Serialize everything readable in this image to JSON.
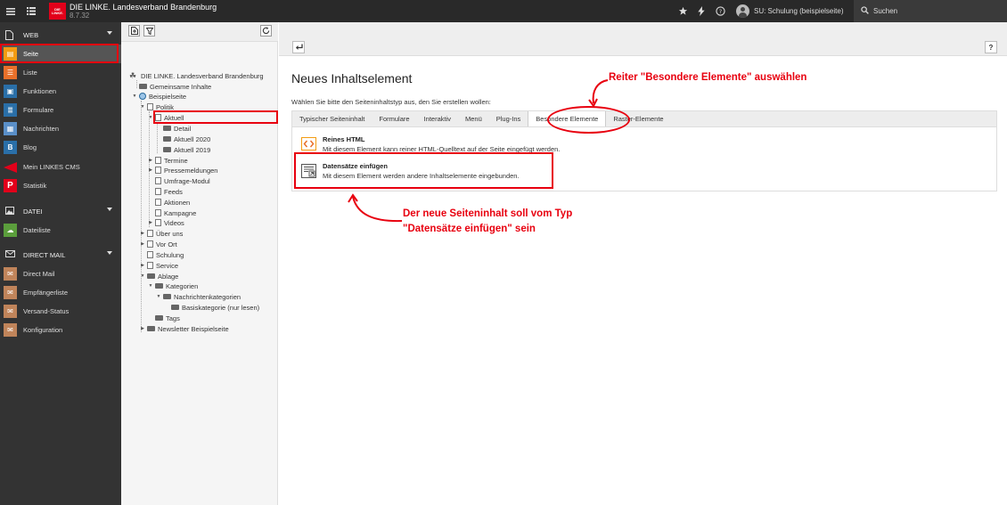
{
  "topbar": {
    "site_title": "DIE LINKE. Landesverband Brandenburg",
    "version": "8.7.32",
    "logo_text": "DIE LINKE.",
    "user": "SU: Schulung (beispielseite)",
    "search_label": "Suchen"
  },
  "modules": {
    "web_label": "WEB",
    "web_items": [
      {
        "label": "Seite",
        "icon": "page-icon",
        "color": "#f39c12"
      },
      {
        "label": "Liste",
        "icon": "list-icon",
        "color": "#e8702a"
      },
      {
        "label": "Funktionen",
        "icon": "briefcase-icon",
        "color": "#2a6fa8"
      },
      {
        "label": "Formulare",
        "icon": "form-icon",
        "color": "#2a6fa8"
      },
      {
        "label": "Nachrichten",
        "icon": "news-icon",
        "color": "#2a6fa8"
      },
      {
        "label": "Blog",
        "icon": "blog-icon",
        "color": "#2a6fa8"
      },
      {
        "label": "Mein LINKES CMS",
        "icon": "linke-arrow-icon",
        "color": "#e2001a"
      },
      {
        "label": "Statistik",
        "icon": "statistics-p-icon",
        "color": "#e2001a"
      }
    ],
    "datei_label": "DATEI",
    "datei_items": [
      {
        "label": "Dateiliste",
        "icon": "cloud-icon",
        "color": "#5b9e3c"
      }
    ],
    "direct_mail_label": "DIRECT MAIL",
    "direct_mail_items": [
      {
        "label": "Direct Mail",
        "icon": "mail-icon",
        "color": "#c0845a"
      },
      {
        "label": "Empfängerliste",
        "icon": "recipients-icon",
        "color": "#c0845a"
      },
      {
        "label": "Versand-Status",
        "icon": "mail-status-icon",
        "color": "#c0845a"
      },
      {
        "label": "Konfiguration",
        "icon": "mail-config-icon",
        "color": "#c0845a"
      }
    ]
  },
  "tree": {
    "root": "DIE LINKE. Landesverband Brandenburg",
    "nodes": [
      "Gemeinsame Inhalte",
      "Beispielseite",
      "Politik",
      "Aktuell",
      "Detail",
      "Aktuell 2020",
      "Aktuell 2019",
      "Termine",
      "Pressemeldungen",
      "Umfrage-Modul",
      "Feeds",
      "Aktionen",
      "Kampagne",
      "Videos",
      "Über uns",
      "Vor Ort",
      "Schulung",
      "Service",
      "Ablage",
      "Kategorien",
      "Nachrichtenkategorien",
      "Basiskategorie (nur lesen)",
      "Tags",
      "Newsletter Beispielseite"
    ]
  },
  "content": {
    "title": "Neues Inhaltselement",
    "intro": "Wählen Sie bitte den Seiteninhaltstyp aus, den Sie erstellen wollen:",
    "help": "?",
    "tabs": [
      "Typischer Seiteninhalt",
      "Formulare",
      "Interaktiv",
      "Menü",
      "Plug-Ins",
      "Besondere Elemente",
      "Raster-Elemente"
    ],
    "elements": [
      {
        "title": "Reines HTML",
        "desc": "Mit diesem Element kann reiner HTML-Quelltext auf der Seite eingefügt werden."
      },
      {
        "title": "Datensätze einfügen",
        "desc": "Mit diesem Element werden andere Inhaltselemente eingebunden."
      }
    ]
  },
  "annotations": {
    "tab_hint": "Reiter \"Besondere Elemente\" auswählen",
    "type_hint_line1": "Der neue Seiteninhalt soll vom Typ",
    "type_hint_line2": "\"Datensätze einfügen\" sein"
  },
  "colors": {
    "annotation": "#e8000f",
    "topbar": "#292929",
    "module_menu": "#333333"
  }
}
